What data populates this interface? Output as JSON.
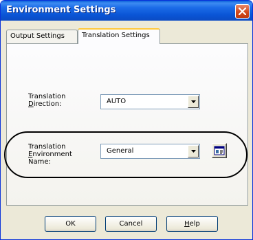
{
  "window": {
    "title": "Environment Settings"
  },
  "tabs": [
    {
      "label": "Output Settings"
    },
    {
      "label": "Translation Settings"
    }
  ],
  "direction": {
    "label_line1": "Translation",
    "label_line2": "Direction:",
    "value": "AUTO"
  },
  "environment": {
    "label_line1": "Translation",
    "label_line2": "Environment",
    "label_line3": "Name:",
    "value": "General"
  },
  "buttons": {
    "ok": "OK",
    "cancel": "Cancel",
    "help": "Help"
  },
  "colors": {
    "titlebar": "#0a55d6",
    "window_bg": "#ece9d8",
    "close": "#d2491d",
    "tab_highlight": "#ffc83c"
  },
  "icons": {
    "close": "close-x-icon",
    "dropdown": "chevron-down-icon",
    "env_button": "environment-settings-icon"
  }
}
